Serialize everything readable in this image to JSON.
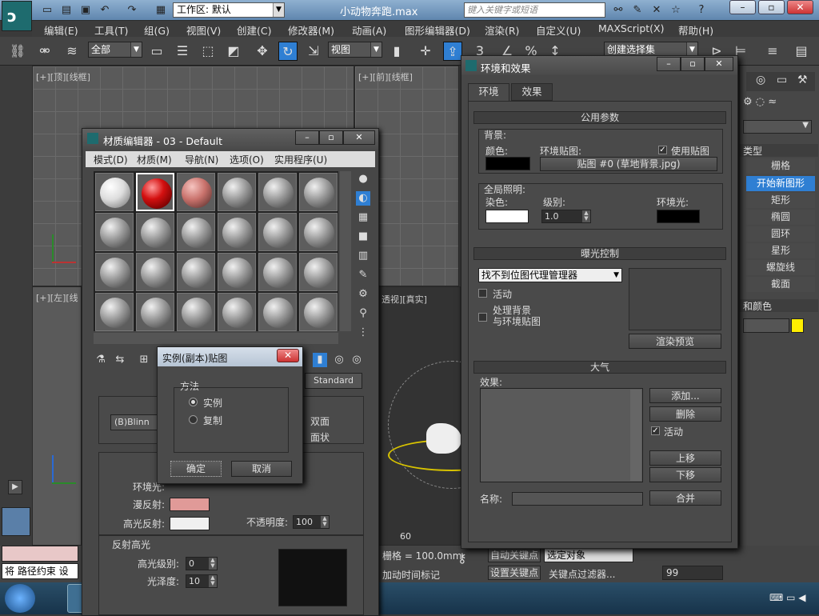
{
  "titlebar": {
    "workspace_label": "工作区: 默认",
    "filename": "小动物奔跑.max",
    "search_placeholder": "键入关键字或短语"
  },
  "menubar": [
    "编辑(E)",
    "工具(T)",
    "组(G)",
    "视图(V)",
    "创建(C)",
    "修改器(M)",
    "动画(A)",
    "图形编辑器(D)",
    "渲染(R)",
    "自定义(U)",
    "MAXScript(X)",
    "帮助(H)"
  ],
  "toolbar": {
    "selection_filter": "全部",
    "ref_coord": "视图",
    "named_selection": "创建选择集"
  },
  "viewports": {
    "top": "[+][顶][线框]",
    "front": "[+][前][线框]",
    "left": "[+][左][线",
    "persp": "透视][真实]"
  },
  "material_editor": {
    "title": "材质编辑器 - 03 - Default",
    "menu": [
      "模式(D)",
      "材质(M)",
      "导航(N)",
      "选项(O)",
      "实用程序(U)"
    ],
    "material_type": "Standard",
    "shader": "(B)Blinn",
    "shader_options": [
      "双面",
      "面状"
    ],
    "labels": {
      "ambient": "环境光:",
      "diffuse": "漫反射:",
      "specular": "高光反射:",
      "opacity": "不透明度:",
      "spec_highlight": "反射高光",
      "spec_level": "高光级别:",
      "glossiness": "光泽度:"
    },
    "values": {
      "opacity": "100",
      "spec_level": "0",
      "glossiness": "10"
    },
    "colors": {
      "diffuse": "#e09a98",
      "specular": "#f0f0f0",
      "ambient": "#e09a98"
    }
  },
  "instance_dialog": {
    "title": "实例(副本)贴图",
    "group": "方法",
    "options": [
      "实例",
      "复制"
    ],
    "selected": "实例",
    "ok": "确定",
    "cancel": "取消"
  },
  "env_dialog": {
    "title": "环境和效果",
    "tabs": [
      "环境",
      "效果"
    ],
    "common_params": "公用参数",
    "background": "背景:",
    "color": "颜色:",
    "env_map": "环境贴图:",
    "use_map": "使用贴图",
    "map_name": "贴图 #0 (草地背景.jpg)",
    "global_lighting": "全局照明:",
    "tint": "染色:",
    "level": "级别:",
    "level_value": "1.0",
    "ambient": "环境光:",
    "exposure_control": "曝光控制",
    "exposure_value": "找不到位图代理管理器",
    "active": "活动",
    "process_bg_line1": "处理背景",
    "process_bg_line2": "与环境贴图",
    "render_preview": "渲染预览",
    "atmosphere": "大气",
    "effects_label": "效果:",
    "add": "添加...",
    "delete": "删除",
    "atm_active": "活动",
    "move_up": "上移",
    "move_down": "下移",
    "name_label": "名称:",
    "merge": "合并",
    "colors": {
      "bg": "#000000",
      "tint": "#ffffff",
      "ambient": "#000000"
    }
  },
  "cmd_panel": {
    "section": "类型",
    "items": [
      "栅格",
      "开始新图形",
      "矩形",
      "椭圆",
      "圆环",
      "星形",
      "螺旋线",
      "截面"
    ],
    "name_color": "和颜色",
    "swatch": "#ffee00"
  },
  "bottom": {
    "status": "将 路径约束 设",
    "grid": "栅格 = 100.0mm",
    "add_time_tag": "加动时间标记",
    "auto_key": "自动关键点",
    "set_key": "设置关键点",
    "selected_obj": "选定对象",
    "key_filters": "关键点过滤器...",
    "frame": "99",
    "timeline_mark": "60"
  }
}
